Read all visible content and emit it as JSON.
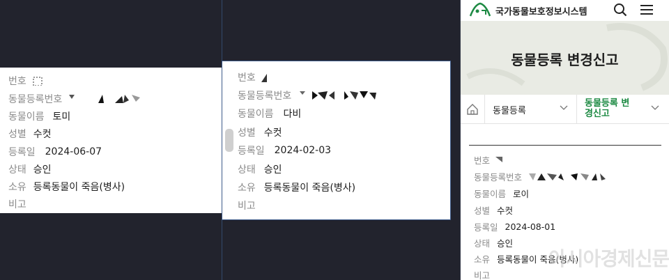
{
  "labels": {
    "number": "번호",
    "reg_no": "동물등록번호",
    "name": "동물이름",
    "sex": "성별",
    "reg_date": "등록일",
    "status": "상태",
    "ownership": "소유",
    "remarks": "비고"
  },
  "records": [
    {
      "name": "토미",
      "sex": "수컷",
      "reg_date": "2024-06-07",
      "status": "승인",
      "ownership": "등록동물이 죽음(병사)",
      "remarks": ""
    },
    {
      "name": "다비",
      "sex": "수컷",
      "reg_date": "2024-02-03",
      "status": "승인",
      "ownership": "등록동물이 죽음(병사)",
      "remarks": ""
    },
    {
      "name": "로이",
      "sex": "수컷",
      "reg_date": "2024-08-01",
      "status": "승인",
      "ownership": "등록동물이 죽음(병사)",
      "remarks": ""
    }
  ],
  "site": {
    "title": "국가동물보호정보시스템",
    "hero_title": "동물등록 변경신고",
    "breadcrumb": [
      "동물등록",
      "동물등록 변경신고"
    ],
    "accent": "#1d8a43",
    "icons": [
      "logo-icon",
      "search-icon",
      "menu-icon",
      "home-icon",
      "chevron-down-icon"
    ]
  },
  "watermark": "아시아경제신문"
}
